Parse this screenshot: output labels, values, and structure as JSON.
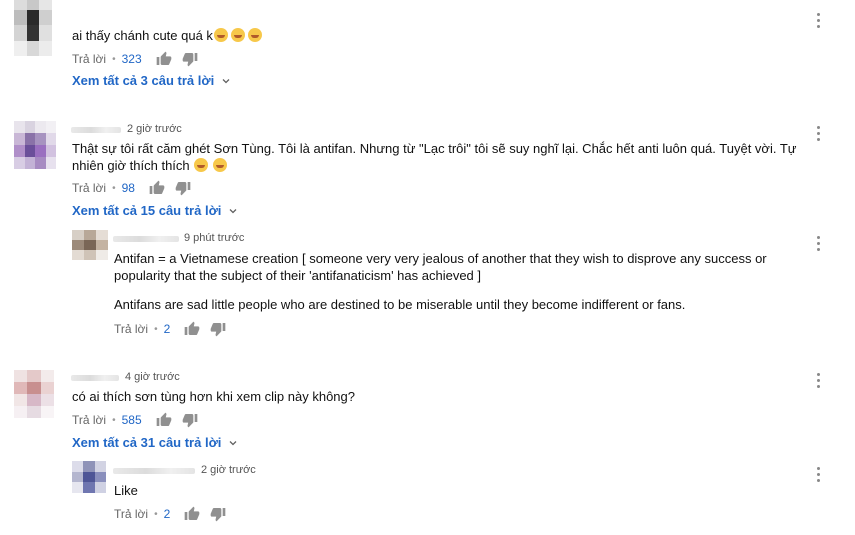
{
  "comments": [
    {
      "time": "",
      "text": "ai thấy chánh cute quá k",
      "emoji_count": 3,
      "reply_label": "Trả lời",
      "likes": "323",
      "view_replies": "Xem tất cả 3 câu trả lời"
    },
    {
      "time": "2 giờ trước",
      "text_line1": "Thật sự tôi rất căm ghét Sơn Tùng. Tôi là antifan. Nhưng từ \"Lạc trôi\" tôi sẽ suy nghĩ lại. Chắc hết anti luôn quá. Tuyệt vời. Tự",
      "text_line2": "nhiên giờ thích thích",
      "reply_label": "Trả lời",
      "likes": "98",
      "view_replies": "Xem tất cả 15 câu trả lời",
      "reply": {
        "time": "9 phút trước",
        "line1": "Antifan = a Vietnamese creation [ someone very very jealous of another that they wish to disprove any success or",
        "line2": "popularity that the subject of their 'antifanaticism' has achieved ]",
        "line3": "Antifans are sad little people who are destined to be miserable until they become indifferent or fans.",
        "reply_label": "Trả lời",
        "likes": "2"
      }
    },
    {
      "time": "4 giờ trước",
      "text": "có ai thích sơn tùng hơn khi xem clip này không?",
      "reply_label": "Trả lời",
      "likes": "585",
      "view_replies": "Xem tất cả 31 câu trả lời",
      "reply": {
        "time": "2 giờ trước",
        "text": "Like",
        "reply_label": "Trả lời",
        "likes": "2"
      }
    }
  ],
  "colors": {
    "link": "#2167c6",
    "meta": "#555555"
  },
  "icons": [
    "thumb-up-icon",
    "thumb-down-icon",
    "more-vert-icon",
    "chevron-down-icon",
    "laughing-emoji-icon",
    "smile-emoji-icon"
  ]
}
